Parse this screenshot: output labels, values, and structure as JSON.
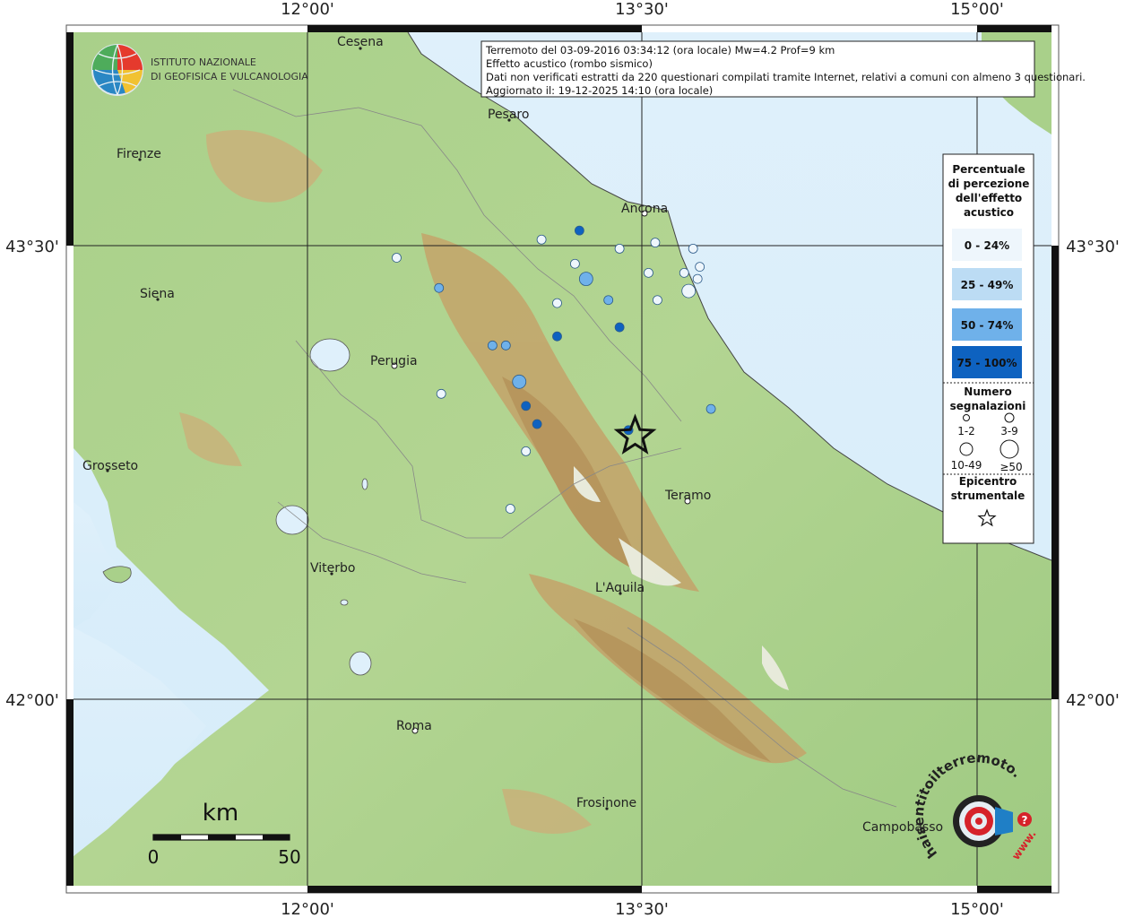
{
  "grid": {
    "lon_labels": [
      "12°00'",
      "13°30'",
      "15°00'"
    ],
    "lat_labels": [
      "43°30'",
      "42°00'"
    ]
  },
  "info": {
    "line1": "Terremoto del 03-09-2016 03:34:12 (ora locale) Mw=4.2 Prof=9 km",
    "line2": "Effetto acustico (rombo sismico)",
    "line3": "Dati non verificati estratti da 220 questionari compilati tramite Internet, relativi a comuni con almeno 3 questionari.",
    "line4": "Aggiornato il: 19-12-2025 14:10 (ora locale)"
  },
  "logo": {
    "line1": "ISTITUTO NAZIONALE",
    "line2": "DI GEOFISICA E VULCANOLOGIA"
  },
  "cities": [
    {
      "name": "Cesena"
    },
    {
      "name": "Pesaro"
    },
    {
      "name": "Firenze"
    },
    {
      "name": "Ancona"
    },
    {
      "name": "Siena"
    },
    {
      "name": "Perugia"
    },
    {
      "name": "Grosseto"
    },
    {
      "name": "Teramo"
    },
    {
      "name": "Viterbo"
    },
    {
      "name": "L'Aquila"
    },
    {
      "name": "Roma"
    },
    {
      "name": "Frosinone"
    },
    {
      "name": "Campobasso"
    }
  ],
  "legend": {
    "title": [
      "Percentuale",
      "di percezione",
      "dell'effetto",
      "acustico"
    ],
    "classes": [
      {
        "label": "0 - 24%",
        "color": "#eef6fc"
      },
      {
        "label": "25 - 49%",
        "color": "#bcdcf4"
      },
      {
        "label": "50 - 74%",
        "color": "#6fb1ea"
      },
      {
        "label": "75 - 100%",
        "color": "#0e62c0"
      }
    ],
    "count_title": [
      "Numero",
      "segnalazioni"
    ],
    "count_sizes": [
      "1-2",
      "3-9",
      "10-49",
      "≥50"
    ],
    "epicenter_title": [
      "Epicentro",
      "strumentale"
    ]
  },
  "scale_bar": {
    "unit": "km",
    "min": "0",
    "max": "50"
  },
  "watermark": {
    "text": "haisentitoilterremoto.it",
    "url_label": "www."
  },
  "observations": [
    {
      "lon": 13.05,
      "lat": 43.52,
      "cls": 0,
      "n": "3-9"
    },
    {
      "lon": 13.22,
      "lat": 43.55,
      "cls": 3,
      "n": "3-9"
    },
    {
      "lon": 13.4,
      "lat": 43.49,
      "cls": 0,
      "n": "3-9"
    },
    {
      "lon": 13.56,
      "lat": 43.51,
      "cls": 0,
      "n": "3-9"
    },
    {
      "lon": 13.73,
      "lat": 43.49,
      "cls": 0,
      "n": "3-9"
    },
    {
      "lon": 12.4,
      "lat": 43.46,
      "cls": 0,
      "n": "3-9"
    },
    {
      "lon": 13.2,
      "lat": 43.44,
      "cls": 0,
      "n": "3-9"
    },
    {
      "lon": 13.76,
      "lat": 43.43,
      "cls": 0,
      "n": "3-9"
    },
    {
      "lon": 13.53,
      "lat": 43.41,
      "cls": 0,
      "n": "3-9"
    },
    {
      "lon": 13.69,
      "lat": 43.41,
      "cls": 0,
      "n": "3-9"
    },
    {
      "lon": 13.25,
      "lat": 43.39,
      "cls": 2,
      "n": "10-49"
    },
    {
      "lon": 13.75,
      "lat": 43.39,
      "cls": 0,
      "n": "3-9"
    },
    {
      "lon": 12.59,
      "lat": 43.36,
      "cls": 2,
      "n": "3-9"
    },
    {
      "lon": 13.71,
      "lat": 43.35,
      "cls": 0,
      "n": "10-49"
    },
    {
      "lon": 13.35,
      "lat": 43.32,
      "cls": 2,
      "n": "3-9"
    },
    {
      "lon": 13.57,
      "lat": 43.32,
      "cls": 0,
      "n": "3-9"
    },
    {
      "lon": 13.12,
      "lat": 43.31,
      "cls": 0,
      "n": "3-9"
    },
    {
      "lon": 13.4,
      "lat": 43.23,
      "cls": 3,
      "n": "3-9"
    },
    {
      "lon": 13.12,
      "lat": 43.2,
      "cls": 3,
      "n": "3-9"
    },
    {
      "lon": 12.83,
      "lat": 43.17,
      "cls": 2,
      "n": "3-9"
    },
    {
      "lon": 12.89,
      "lat": 43.17,
      "cls": 2,
      "n": "3-9"
    },
    {
      "lon": 12.95,
      "lat": 43.05,
      "cls": 2,
      "n": "10-49"
    },
    {
      "lon": 12.6,
      "lat": 43.01,
      "cls": 0,
      "n": "3-9"
    },
    {
      "lon": 12.98,
      "lat": 42.97,
      "cls": 3,
      "n": "3-9"
    },
    {
      "lon": 13.81,
      "lat": 42.96,
      "cls": 2,
      "n": "3-9"
    },
    {
      "lon": 13.03,
      "lat": 42.91,
      "cls": 3,
      "n": "3-9"
    },
    {
      "lon": 13.44,
      "lat": 42.89,
      "cls": 3,
      "n": "3-9"
    },
    {
      "lon": 12.98,
      "lat": 42.82,
      "cls": 0,
      "n": "3-9"
    },
    {
      "lon": 12.91,
      "lat": 42.63,
      "cls": 0,
      "n": "3-9"
    }
  ],
  "epicenter": {
    "lon": 13.47,
    "lat": 42.87
  }
}
